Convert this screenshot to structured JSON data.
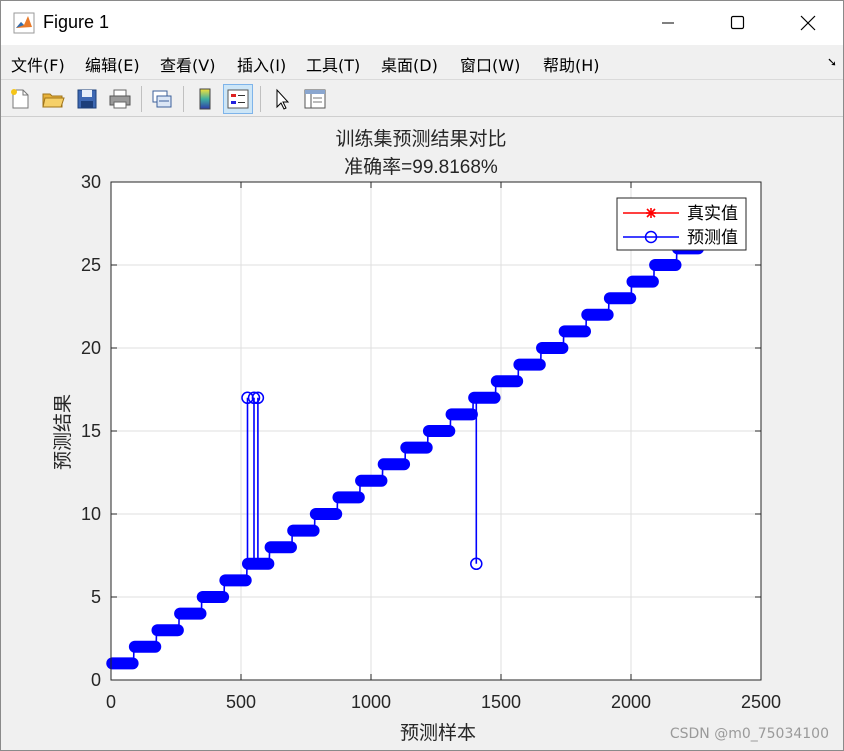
{
  "window": {
    "title": "Figure 1",
    "controls": [
      "minimize",
      "maximize",
      "close"
    ]
  },
  "menubar": {
    "items": [
      "文件(F)",
      "编辑(E)",
      "查看(V)",
      "插入(I)",
      "工具(T)",
      "桌面(D)",
      "窗口(W)",
      "帮助(H)"
    ],
    "corner_icon": "dock-arrow-icon"
  },
  "toolbar": {
    "buttons": [
      "new-figure-icon",
      "open-file-icon",
      "save-icon",
      "print-icon",
      "link-plot-icon",
      "colorbar-icon",
      "legend-icon",
      "pointer-icon",
      "property-inspector-icon"
    ],
    "active": "legend-icon"
  },
  "chart_data": {
    "type": "line",
    "title": "训练集预测结果对比",
    "subtitle": "准确率=99.8168%",
    "xlabel": "预测样本",
    "ylabel": "预测结果",
    "xlim": [
      0,
      2500
    ],
    "ylim": [
      0,
      30
    ],
    "xticks": [
      "0",
      "500",
      "1000",
      "1500",
      "2000",
      "2500"
    ],
    "yticks": [
      "0",
      "5",
      "10",
      "15",
      "20",
      "25",
      "30"
    ],
    "grid": true,
    "legend_position": "top-right",
    "series": [
      {
        "name": "真实值",
        "color": "#ff0000",
        "marker": "asterisk",
        "description": "step function, class k for samples in each class block"
      },
      {
        "name": "预测值",
        "color": "#0000ff",
        "marker": "circle"
      }
    ],
    "class_blocks": [
      {
        "class": 1,
        "x_start": 1,
        "x_end": 87
      },
      {
        "class": 2,
        "x_start": 88,
        "x_end": 174
      },
      {
        "class": 3,
        "x_start": 175,
        "x_end": 261
      },
      {
        "class": 4,
        "x_start": 262,
        "x_end": 348
      },
      {
        "class": 5,
        "x_start": 349,
        "x_end": 435
      },
      {
        "class": 6,
        "x_start": 436,
        "x_end": 522
      },
      {
        "class": 7,
        "x_start": 523,
        "x_end": 609
      },
      {
        "class": 8,
        "x_start": 610,
        "x_end": 696
      },
      {
        "class": 9,
        "x_start": 697,
        "x_end": 783
      },
      {
        "class": 10,
        "x_start": 784,
        "x_end": 870
      },
      {
        "class": 11,
        "x_start": 871,
        "x_end": 957
      },
      {
        "class": 12,
        "x_start": 958,
        "x_end": 1044
      },
      {
        "class": 13,
        "x_start": 1045,
        "x_end": 1131
      },
      {
        "class": 14,
        "x_start": 1132,
        "x_end": 1218
      },
      {
        "class": 15,
        "x_start": 1219,
        "x_end": 1305
      },
      {
        "class": 16,
        "x_start": 1306,
        "x_end": 1392
      },
      {
        "class": 17,
        "x_start": 1393,
        "x_end": 1479
      },
      {
        "class": 18,
        "x_start": 1480,
        "x_end": 1566
      },
      {
        "class": 19,
        "x_start": 1567,
        "x_end": 1653
      },
      {
        "class": 20,
        "x_start": 1654,
        "x_end": 1740
      },
      {
        "class": 21,
        "x_start": 1741,
        "x_end": 1827
      },
      {
        "class": 22,
        "x_start": 1828,
        "x_end": 1914
      },
      {
        "class": 23,
        "x_start": 1915,
        "x_end": 2001
      },
      {
        "class": 24,
        "x_start": 2002,
        "x_end": 2088
      },
      {
        "class": 25,
        "x_start": 2089,
        "x_end": 2175
      },
      {
        "class": 26,
        "x_start": 2176,
        "x_end": 2262
      }
    ],
    "mispredictions": [
      {
        "x": 525,
        "true": 7,
        "predicted": 17
      },
      {
        "x": 550,
        "true": 7,
        "predicted": 17
      },
      {
        "x": 565,
        "true": 7,
        "predicted": 17
      },
      {
        "x": 1405,
        "true": 17,
        "predicted": 7
      }
    ]
  },
  "watermark": "CSDN @m0_75034100"
}
